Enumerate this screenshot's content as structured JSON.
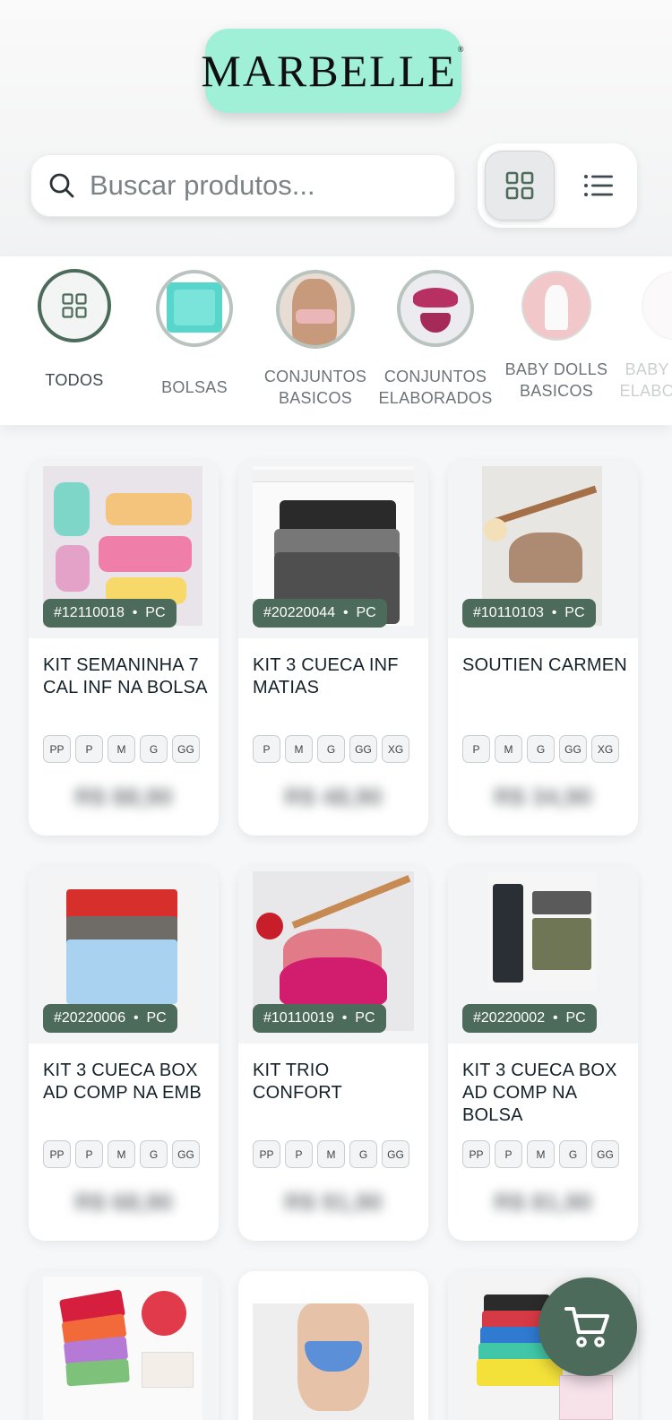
{
  "brand": {
    "name": "MARBELLE",
    "reg_mark": "®"
  },
  "search": {
    "placeholder": "Buscar produtos..."
  },
  "view_toggle": {
    "active": "grid"
  },
  "categories": [
    {
      "label": "TODOS",
      "icon": "grid-icon"
    },
    {
      "label": "BOLSAS",
      "icon": "bags-photo"
    },
    {
      "label": "CONJUNTOS BASICOS",
      "icon": "basic-set-photo"
    },
    {
      "label": "CONJUNTOS ELABORADOS",
      "icon": "elaborate-set-photo"
    },
    {
      "label": "BABY DOLLS BASICOS",
      "icon": "baby-doll-photo"
    },
    {
      "label": "BABY DOLLS ELABORADOS",
      "icon": "baby-doll-photo"
    }
  ],
  "products": [
    {
      "code": "#12110018",
      "unit": "PC",
      "title": "KIT SEMANINHA 7 CAL INF NA BOLSA",
      "sizes": [
        "PP",
        "P",
        "M",
        "G",
        "GG"
      ],
      "price": "R$ 88,90"
    },
    {
      "code": "#20220044",
      "unit": "PC",
      "title": "KIT 3 CUECA INF MATIAS",
      "sizes": [
        "P",
        "M",
        "G",
        "GG",
        "XG"
      ],
      "price": "R$ 48,90"
    },
    {
      "code": "#10110103",
      "unit": "PC",
      "title": "SOUTIEN CARMEN",
      "sizes": [
        "P",
        "M",
        "G",
        "GG",
        "XG"
      ],
      "price": "R$ 34,90"
    },
    {
      "code": "#20220006",
      "unit": "PC",
      "title": "KIT 3 CUECA BOX AD COMP NA EMB",
      "sizes": [
        "PP",
        "P",
        "M",
        "G",
        "GG"
      ],
      "price": "R$ 68,90"
    },
    {
      "code": "#10110019",
      "unit": "PC",
      "title": "KIT TRIO CONFORT",
      "sizes": [
        "PP",
        "P",
        "M",
        "G",
        "GG"
      ],
      "price": "R$ 91,90"
    },
    {
      "code": "#20220002",
      "unit": "PC",
      "title": "KIT 3 CUECA BOX AD COMP NA BOLSA",
      "sizes": [
        "PP",
        "P",
        "M",
        "G",
        "GG"
      ],
      "price": "R$ 81,90"
    }
  ],
  "colors": {
    "accent": "#4d6b5b",
    "logo_bg": "#9ff0d6"
  }
}
